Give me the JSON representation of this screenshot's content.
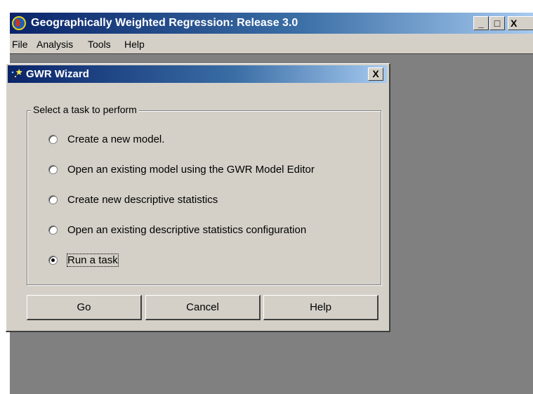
{
  "window": {
    "title": "Geographically Weighted Regression: Release 3.0",
    "controls": {
      "minimize": "_",
      "maximize": "□",
      "close": "X"
    }
  },
  "menu": {
    "items": [
      {
        "label": "File"
      },
      {
        "label": "Analysis"
      },
      {
        "label": "Tools"
      },
      {
        "label": "Help"
      }
    ]
  },
  "dialog": {
    "title": "GWR Wizard",
    "close": "X",
    "group_label": "Select a task to perform",
    "options": [
      {
        "label": "Create a new model.",
        "checked": false
      },
      {
        "label": "Open an existing model using the GWR Model Editor",
        "checked": false
      },
      {
        "label": "Create new descriptive statistics",
        "checked": false
      },
      {
        "label": "Open an existing descriptive statistics configuration",
        "checked": false
      },
      {
        "label": "Run a task",
        "checked": true
      }
    ],
    "buttons": {
      "go": "Go",
      "cancel": "Cancel",
      "help": "Help"
    }
  },
  "colors": {
    "title_bar_start": "#0a246a",
    "title_bar_end": "#a6caf0",
    "face": "#d4d0c8",
    "workspace": "#808080"
  }
}
